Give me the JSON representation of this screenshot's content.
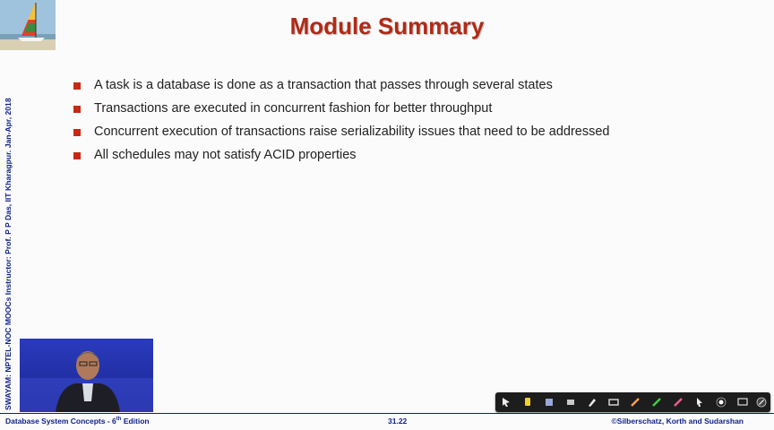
{
  "slide": {
    "title": "Module Summary",
    "side_text": "SWAYAM: NPTEL-NOC MOOCs Instructor: Prof. P P Das, IIT Kharagpur. Jan-Apr, 2018",
    "bullets": [
      "A task is a database is done as a transaction that passes through several states",
      "Transactions are executed in concurrent fashion for better throughput",
      "Concurrent execution of transactions raise serializability issues that need to be addressed",
      "All schedules may not satisfy ACID properties"
    ]
  },
  "footer": {
    "left_prefix": "Database System Concepts - 6",
    "left_sup": "th",
    "left_suffix": " Edition",
    "center": "31.22",
    "right": "©Silberschatz, Korth and Sudarshan"
  },
  "toolbar": {
    "tools": [
      "pointer-icon",
      "highlighter-icon",
      "pen-icon",
      "eraser-icon",
      "marker-icon",
      "shapes-icon",
      "pencil-icon",
      "green-pen-icon",
      "red-pen-icon",
      "cursor-icon",
      "laser-icon",
      "screen-icon",
      "close-icon"
    ]
  },
  "colors": {
    "title": "#b22a16",
    "bullet": "#c62a14",
    "footer": "#0d1f8a",
    "toolbar": "#1d1d1d"
  }
}
